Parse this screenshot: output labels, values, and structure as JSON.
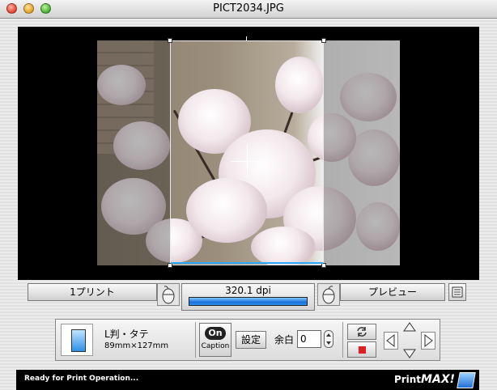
{
  "window": {
    "title": "PICT2034.JPG"
  },
  "toolbar": {
    "print_count_label": "1プリント",
    "dpi_value": "320.1 dpi",
    "dpi_progress": 1.0,
    "preview_label": "プレビュー"
  },
  "paper": {
    "name": "L判・タテ",
    "size": "89mm×127mm"
  },
  "caption": {
    "badge": "On",
    "label": "Caption"
  },
  "settings": {
    "button_label": "設定",
    "margin_label": "余白",
    "margin_value": "0"
  },
  "status": {
    "message": "Ready for Print Operation...",
    "logo_text": "Print",
    "logo_bold": "MAX!"
  },
  "colors": {
    "accent": "#2aa9ff",
    "progress": "#1d6fd8",
    "status_bg": "#000000",
    "stop": "#e02020"
  },
  "icons": [
    "mouse-icon",
    "menu-icon",
    "paper-icon",
    "rotate-icon",
    "stop-icon",
    "arrow-up-icon",
    "arrow-down-icon",
    "arrow-left-icon",
    "arrow-right-icon",
    "stepper-icon"
  ]
}
